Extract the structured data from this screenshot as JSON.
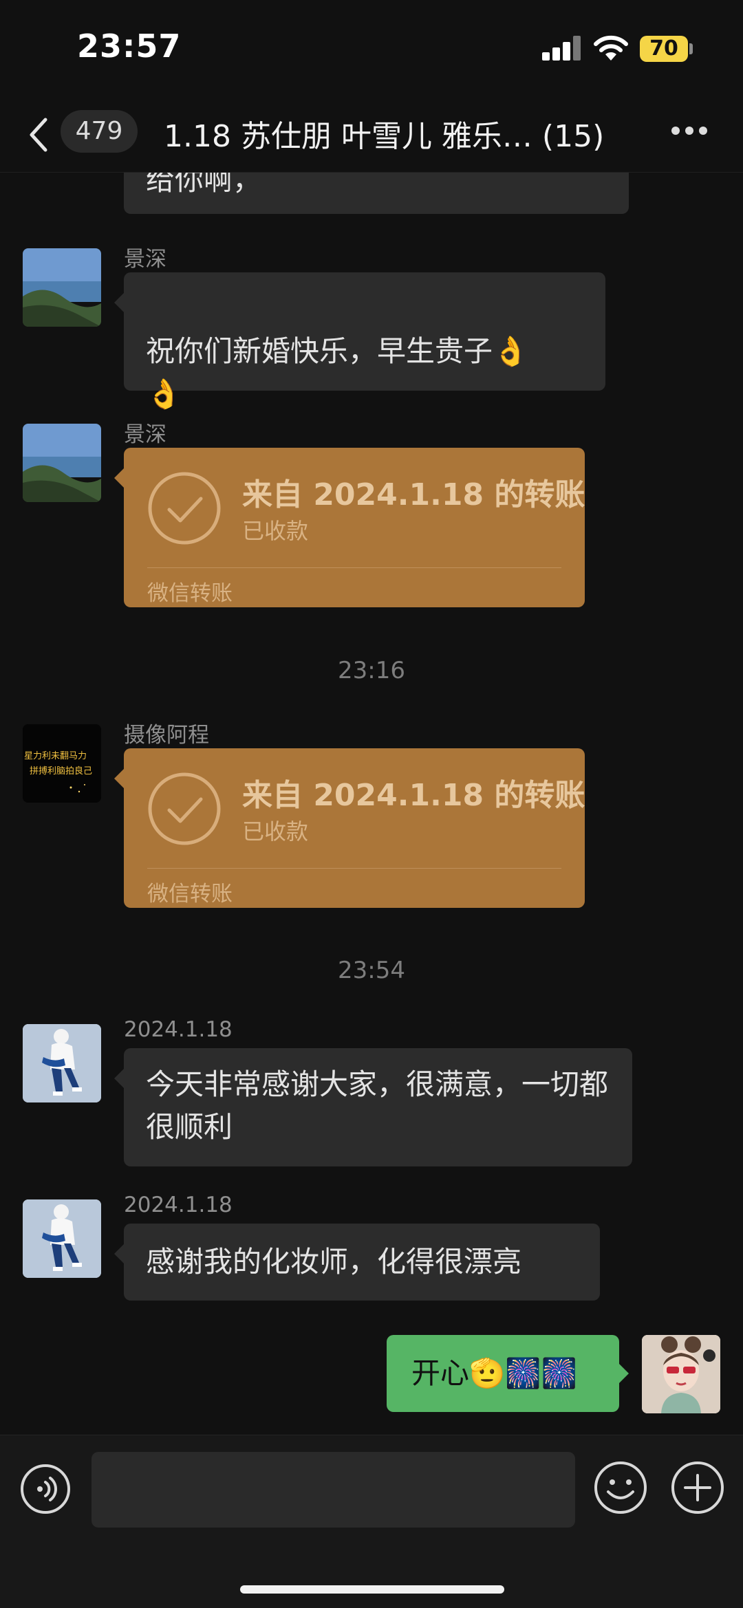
{
  "status_bar": {
    "time": "23:57",
    "battery": "70"
  },
  "nav": {
    "unread_count": "479",
    "title": "1.18 苏仕朋 叶雪儿 雅乐… (15)"
  },
  "messages": {
    "partial_top": "给你啊，",
    "m1": {
      "sender": "景深",
      "text": "祝你们新婚快乐，早生贵子👌\n👌"
    },
    "m2": {
      "sender": "景深",
      "transfer_title": "来自 2024.1.18 的转账",
      "transfer_status": "已收款",
      "transfer_footer": "微信转账"
    },
    "ts1": "23:16",
    "m3": {
      "sender": "摄像阿程",
      "transfer_title": "来自 2024.1.18 的转账",
      "transfer_status": "已收款",
      "transfer_footer": "微信转账"
    },
    "ts2": "23:54",
    "m4": {
      "sender": "2024.1.18",
      "text": "今天非常感谢大家，很满意，一切都很顺利"
    },
    "m5": {
      "sender": "2024.1.18",
      "text": "感谢我的化妆师，化得很漂亮"
    },
    "m6": {
      "text": "开心🫡🎆🎆"
    }
  },
  "colors": {
    "background": "#111111",
    "bubble": "#2c2c2c",
    "transfer": "#ab7639",
    "my_bubble": "#56b565"
  },
  "icons": [
    "back-icon",
    "more-icon",
    "voice-icon",
    "emoji-icon",
    "plus-icon",
    "check-circle-icon"
  ]
}
